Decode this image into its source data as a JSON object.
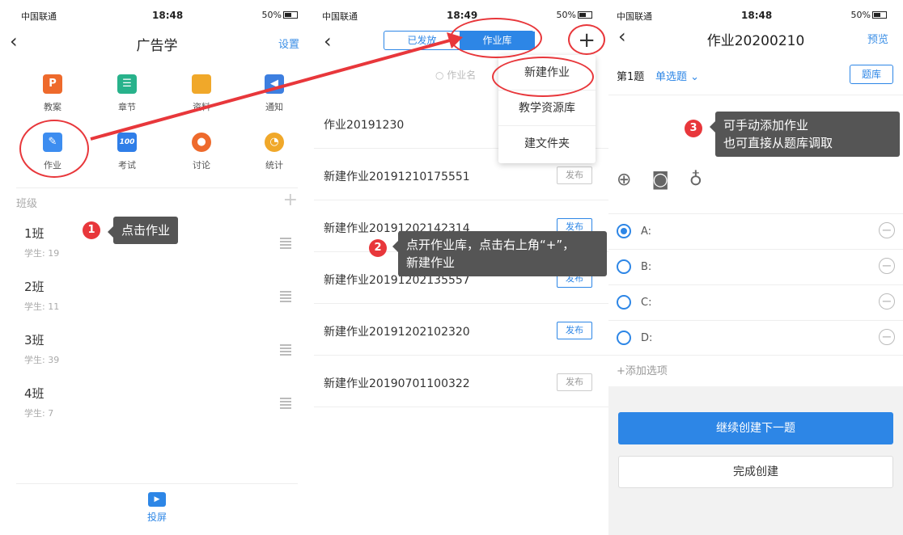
{
  "status": {
    "carrier": "中国联通",
    "time1": "18:48",
    "time2": "18:49",
    "time3": "18:48",
    "battery": "50%"
  },
  "p1": {
    "title": "广告学",
    "settings": "设置",
    "grid": [
      {
        "label": "教案",
        "icon": "P",
        "color": "#ee6a2c"
      },
      {
        "label": "章节",
        "icon": "☰",
        "color": "#28b28b"
      },
      {
        "label": "资料",
        "icon": "",
        "color": "#f0a82a"
      },
      {
        "label": "通知",
        "icon": "◀",
        "color": "#3d7fe0"
      },
      {
        "label": "作业",
        "icon": "✎",
        "color": "#3d8df0"
      },
      {
        "label": "考试",
        "icon": "100",
        "color": "#2f7ee8"
      },
      {
        "label": "讨论",
        "icon": "●",
        "color": "#ee6a2c"
      },
      {
        "label": "统计",
        "icon": "◔",
        "color": "#f0a82a"
      }
    ],
    "section": "班级",
    "classes": [
      {
        "name": "1班",
        "students": "学生: 19"
      },
      {
        "name": "2班",
        "students": "学生: 11"
      },
      {
        "name": "3班",
        "students": "学生: 39"
      },
      {
        "name": "4班",
        "students": "学生: 7"
      }
    ],
    "tab": "投屏"
  },
  "p2": {
    "tab_published": "已发放",
    "tab_library": "作业库",
    "search": "作业名",
    "homeworks": [
      {
        "name": "作业20191230",
        "action": ""
      },
      {
        "name": "新建作业20191210175551",
        "action": "发布"
      },
      {
        "name": "新建作业20191202142314",
        "action": "发布"
      },
      {
        "name": "新建作业20191202135557",
        "action": "发布"
      },
      {
        "name": "新建作业20191202102320",
        "action": "发布"
      },
      {
        "name": "新建作业20190701100322",
        "action": "发布"
      }
    ],
    "menu": [
      "新建作业",
      "教学资源库",
      "建文件夹"
    ]
  },
  "p3": {
    "title": "作业20200210",
    "preview": "预览",
    "question_no": "第1题",
    "question_type": "单选题",
    "bank": "题库",
    "options": [
      "A:",
      "B:",
      "C:",
      "D:"
    ],
    "add_option": "+添加选项",
    "next": "继续创建下一题",
    "finish": "完成创建"
  },
  "annotations": {
    "n1": "1",
    "n2": "2",
    "n3": "3",
    "tip1": "点击作业",
    "tip2a": "点开作业库，点击右上角“+”，",
    "tip2b": "新建作业",
    "tip3a": "可手动添加作业",
    "tip3b": "也可直接从题库调取"
  }
}
